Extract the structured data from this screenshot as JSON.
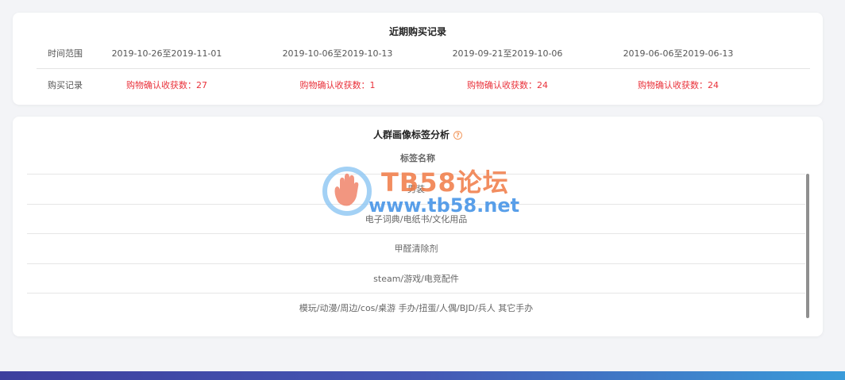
{
  "purchase_records": {
    "title": "近期购买记录",
    "time_label": "时间范围",
    "record_label": "购买记录",
    "columns": [
      {
        "range": "2019-10-26至2019-11-01",
        "record": "购物确认收获数：27"
      },
      {
        "range": "2019-10-06至2019-10-13",
        "record": "购物确认收获数：1"
      },
      {
        "range": "2019-09-21至2019-10-06",
        "record": "购物确认收获数：24"
      },
      {
        "range": "2019-06-06至2019-06-13",
        "record": "购物确认收获数：24"
      }
    ]
  },
  "crowd_tags": {
    "title": "人群画像标签分析",
    "help_icon": "question-circle-icon",
    "column_header": "标签名称",
    "rows": [
      "男装",
      "电子词典/电纸书/文化用品",
      "甲醛清除剂",
      "steam/游戏/电竞配件",
      "模玩/动漫/周边/cos/桌游 手办/扭蛋/人偶/BJD/兵人 其它手办"
    ]
  },
  "watermark": {
    "title": "TB58论坛",
    "url": "www.tb58.net",
    "logo_icon": "hand-logo-icon"
  },
  "colors": {
    "record_red": "#e9313a",
    "watermark_orange": "#f07a45",
    "watermark_blue": "#3d8fe6",
    "bar_start": "#3d3f9e",
    "bar_end": "#3a9bd9"
  }
}
